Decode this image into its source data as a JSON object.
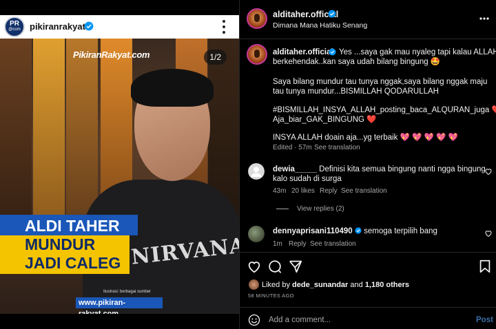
{
  "left_post": {
    "username": "pikiranrakyat",
    "avatar_text": "PR",
    "avatar_sub": "@com",
    "counter": "1/2",
    "watermark": "PikiranRakyat.com",
    "headline_line1": "ALDI TAHER",
    "headline_line2": "MUNDUR",
    "headline_line3": "JADI CALEG",
    "shirt_text": "NIRVANA",
    "photo_credit": "Ilustrasi: berbagai sumber",
    "site": "www.pikiran-rakyat.com"
  },
  "header": {
    "username": "alditaher.official",
    "subtitle": "Dimana Mana Hatiku Senang"
  },
  "caption": {
    "username": "alditaher.official",
    "line1_rest": "Yes ...saya gak mau nyaleg tapi kalau ALLAH",
    "line2": "berkehendak..kan saya udah bilang bingung 🤩",
    "line3": "Saya bilang mundur tau tunya nggak,saya bilang nggak maju",
    "line4": "tau tunya mundur...BISMILLAH QODARULLAH",
    "line5": "#BISMILLAH_INSYA_ALLAH_posting_baca_ALQURAN_juga ❤️",
    "line6": "Aja_biar_GAK_BINGUNG ❤️",
    "line7": "INSYA ALLAH doain aja...yg terbaik 💖 💖 💖 💖 💖",
    "edited": "Edited · 57m",
    "see_translation": "See translation"
  },
  "comments": [
    {
      "username": "dewia_____",
      "text": "Definisi kita semua bingung nanti ngga bingung",
      "text_line2": "kalo sudah di surga",
      "time": "43m",
      "likes": "20 likes",
      "reply": "Reply",
      "see_translation": "See translation",
      "view_replies": "View replies (2)"
    },
    {
      "username": "dennyaprisani110490",
      "text": "semoga terpilih bang",
      "time": "1m",
      "reply": "Reply",
      "see_translation": "See translation"
    }
  ],
  "likes": {
    "prefix": "Liked by ",
    "user": "dede_sunandar",
    "middle": " and ",
    "count": "1,180 others"
  },
  "timestamp": "58 MINUTES AGO",
  "add_comment": {
    "placeholder": "Add a comment...",
    "post_label": "Post"
  },
  "colors": {
    "background": "#000000",
    "verified": "#0095f6",
    "heart": "#ff3040",
    "post_button": "#3d6fa8",
    "muted_text": "#a8a8a8"
  }
}
